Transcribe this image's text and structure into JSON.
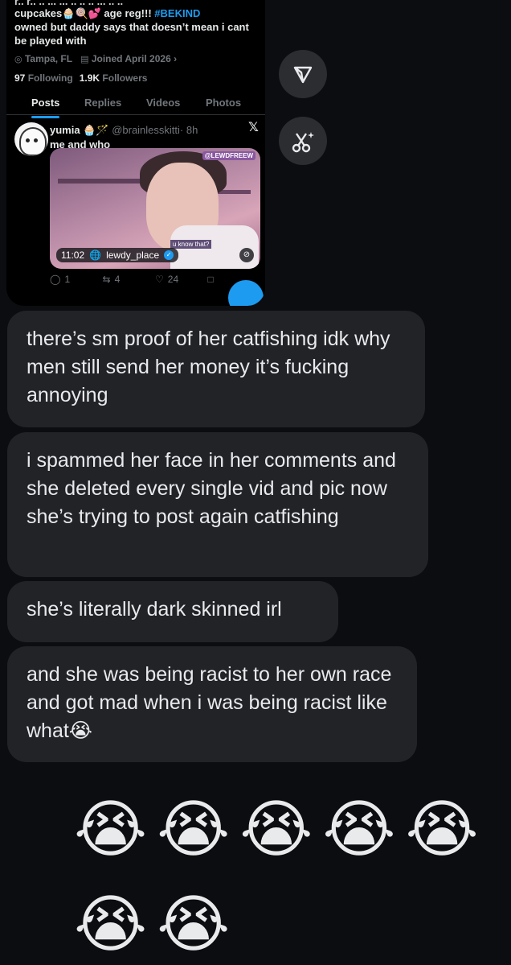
{
  "profile": {
    "bio_cut_line": "r.. r.. .. ... ... .. .. .. ... .. ..",
    "bio_line1_pre": "cupcakes🧁🍭💕 age reg!!! ",
    "bio_tag": "#BEKIND",
    "bio_line2": "owned but daddy says that doesn’t mean i cant",
    "bio_line3": "be played with",
    "location": "Tampa, FL",
    "joined": "Joined April 2026",
    "following_count": "97",
    "following_label": "Following",
    "followers_count": "1.9K",
    "followers_label": "Followers"
  },
  "tabs": [
    "Posts",
    "Replies",
    "Videos",
    "Photos"
  ],
  "post": {
    "name": "yumia 🧁🪄",
    "handle": "@brainlesskitti",
    "time": "· 8h",
    "text": "me and who",
    "media_watermark": "@LEWDFREEW",
    "media_subtitle": "u know that?",
    "video_time": "11:02",
    "video_account": "lewdy_place",
    "replies": "1",
    "reposts": "4",
    "likes": "24"
  },
  "messages": [
    "there’s sm proof of her catfishing idk why men still send her money it’s fucking annoying",
    "i spammed her face in her comments and she deleted every single vid and pic now she’s trying to post again catfishing",
    "she’s literally dark skinned irl",
    "and she was being racist to her own race and got mad when i was being racist like what😭"
  ],
  "emoji_row1": "😭😭😭😭😭",
  "emoji_row2": "😭😭",
  "colors": {
    "background": "#0b0d10",
    "bubble": "#212327",
    "accent": "#1d9bf0"
  },
  "icons": {
    "share": "send-icon",
    "cut": "scissors-sparkle-icon"
  }
}
